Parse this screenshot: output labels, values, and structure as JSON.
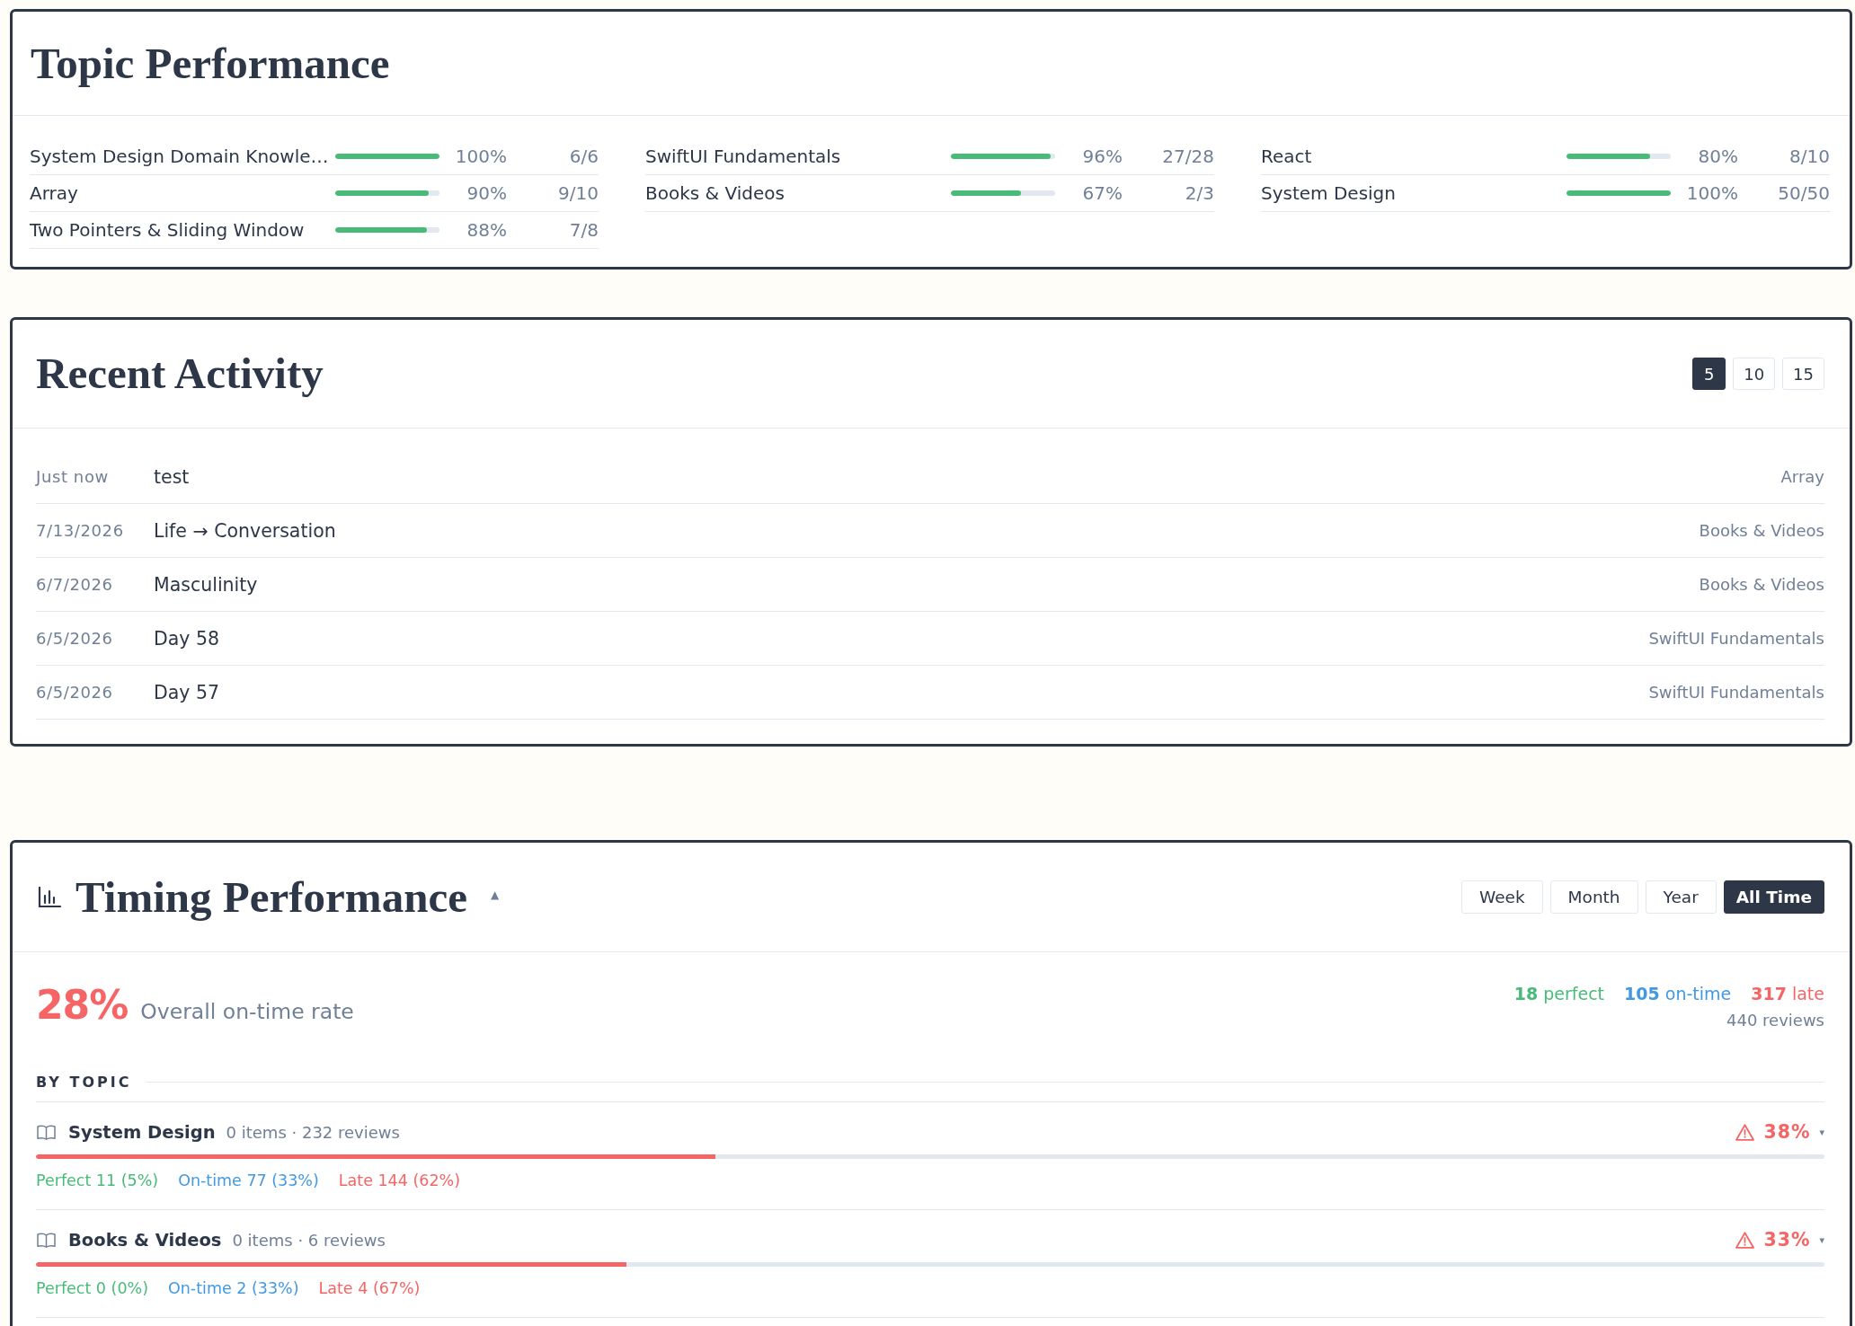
{
  "topic_performance": {
    "title": "Topic Performance",
    "columns": [
      {
        "topics": [
          {
            "name": "System Design Domain Knowle…",
            "level": 1.0,
            "percent": "100%",
            "count": "6/6"
          },
          {
            "name": "Array",
            "level": 0.9,
            "percent": "90%",
            "count": "9/10"
          },
          {
            "name": "Two Pointers & Sliding Window",
            "level": 0.88,
            "percent": "88%",
            "count": "7/8"
          }
        ]
      },
      {
        "topics": [
          {
            "name": "SwiftUI Fundamentals",
            "level": 0.96,
            "percent": "96%",
            "count": "27/28"
          },
          {
            "name": "Books & Videos",
            "level": 0.67,
            "percent": "67%",
            "count": "2/3"
          }
        ]
      },
      {
        "topics": [
          {
            "name": "React",
            "level": 0.8,
            "percent": "80%",
            "count": "8/10"
          },
          {
            "name": "System Design",
            "level": 1.0,
            "percent": "100%",
            "count": "50/50"
          }
        ]
      }
    ]
  },
  "recent_activity": {
    "title": "Recent Activity",
    "page_sizes": [
      {
        "label": "5",
        "selected": true
      },
      {
        "label": "10",
        "selected": false
      },
      {
        "label": "15",
        "selected": false
      }
    ],
    "items": [
      {
        "time": "Just now",
        "title": "test",
        "topic": "Array"
      },
      {
        "time": "7/13/2026",
        "title": "Life → Conversation",
        "topic": "Books & Videos"
      },
      {
        "time": "6/7/2026",
        "title": "Masculinity",
        "topic": "Books & Videos"
      },
      {
        "time": "6/5/2026",
        "title": "Day 58",
        "topic": "SwiftUI Fundamentals"
      },
      {
        "time": "6/5/2026",
        "title": "Day 57",
        "topic": "SwiftUI Fundamentals"
      }
    ]
  },
  "timing_performance": {
    "title": "Timing Performance",
    "toggle": "▲",
    "ranges": [
      {
        "label": "Week",
        "selected": false
      },
      {
        "label": "Month",
        "selected": false
      },
      {
        "label": "Year",
        "selected": false
      },
      {
        "label": "All Time",
        "selected": true
      }
    ],
    "overall": {
      "rate": "28%",
      "label": "Overall on-time rate"
    },
    "summary": [
      {
        "count": "18",
        "label": "perfect",
        "color": "#48bb78"
      },
      {
        "count": "105",
        "label": "on-time",
        "color": "#4299e1"
      },
      {
        "count": "317",
        "label": "late",
        "color": "#f56565"
      }
    ],
    "reviews": "440 reviews",
    "by_topic": {
      "heading": "BY TOPIC",
      "topics": [
        {
          "name": "System Design",
          "meta": "0 items · 232 reviews",
          "warning": true,
          "rate": "38%",
          "level": 0.38,
          "toggle": "▾",
          "breakdown": [
            {
              "label": "Perfect 11 (5%)",
              "color": "#48bb78"
            },
            {
              "label": "On-time 77 (33%)",
              "color": "#4299e1"
            },
            {
              "label": "Late 144 (62%)",
              "color": "#f56565"
            }
          ]
        },
        {
          "name": "Books & Videos",
          "meta": "0 items · 6 reviews",
          "warning": true,
          "rate": "33%",
          "level": 0.33,
          "toggle": "▾",
          "breakdown": [
            {
              "label": "Perfect 0 (0%)",
              "color": "#48bb78"
            },
            {
              "label": "On-time 2 (33%)",
              "color": "#4299e1"
            },
            {
              "label": "Late 4 (67%)",
              "color": "#f56565"
            }
          ]
        }
      ]
    }
  }
}
